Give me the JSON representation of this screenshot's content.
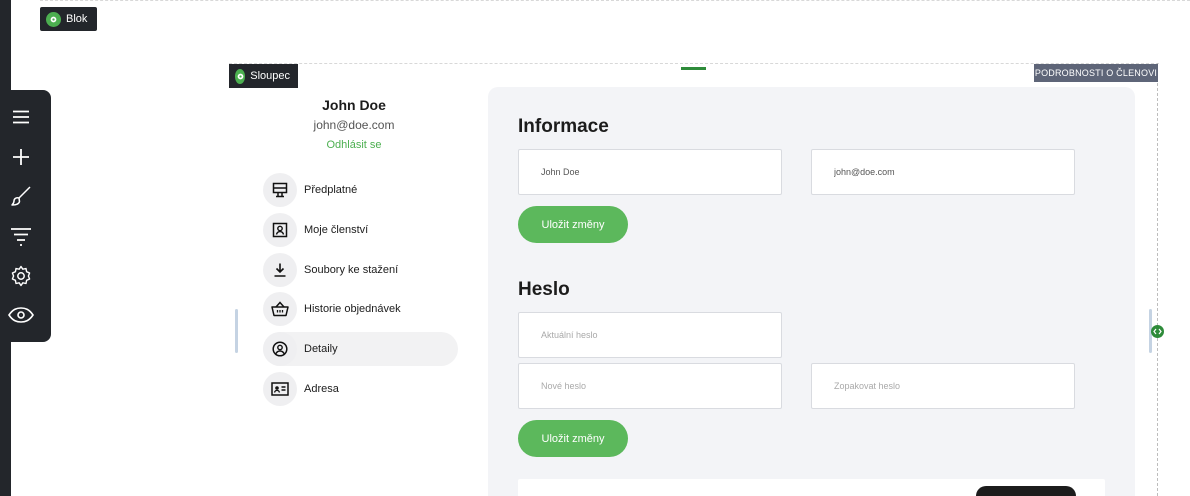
{
  "builder": {
    "block_label": "Blok",
    "column_label": "Sloupec",
    "section_tag": "PODROBNOSTI O ČLENOVI",
    "toolbar": [
      "menu-icon",
      "plus-icon",
      "brush-icon",
      "filter-icon",
      "gear-icon",
      "eye-icon"
    ]
  },
  "profile": {
    "name": "John Doe",
    "email": "john@doe.com",
    "logout": "Odhlásit se"
  },
  "nav": {
    "items": [
      {
        "label": "Předplatné",
        "icon": "subscription-icon"
      },
      {
        "label": "Moje členství",
        "icon": "membership-icon"
      },
      {
        "label": "Soubory ke stažení",
        "icon": "download-icon"
      },
      {
        "label": "Historie objednávek",
        "icon": "basket-icon"
      },
      {
        "label": "Detaily",
        "icon": "user-circle-icon",
        "active": true
      },
      {
        "label": "Adresa",
        "icon": "address-card-icon"
      }
    ]
  },
  "info": {
    "title": "Informace",
    "name_value": "John Doe",
    "email_value": "john@doe.com",
    "save_label": "Uložit změny"
  },
  "password": {
    "title": "Heslo",
    "current_placeholder": "Aktuální heslo",
    "new_placeholder": "Nové heslo",
    "repeat_placeholder": "Zopakovat heslo",
    "save_label": "Uložit změny"
  },
  "colors": {
    "accent": "#5cb85c",
    "dark": "#23262b",
    "panel": "#f3f4f7"
  }
}
